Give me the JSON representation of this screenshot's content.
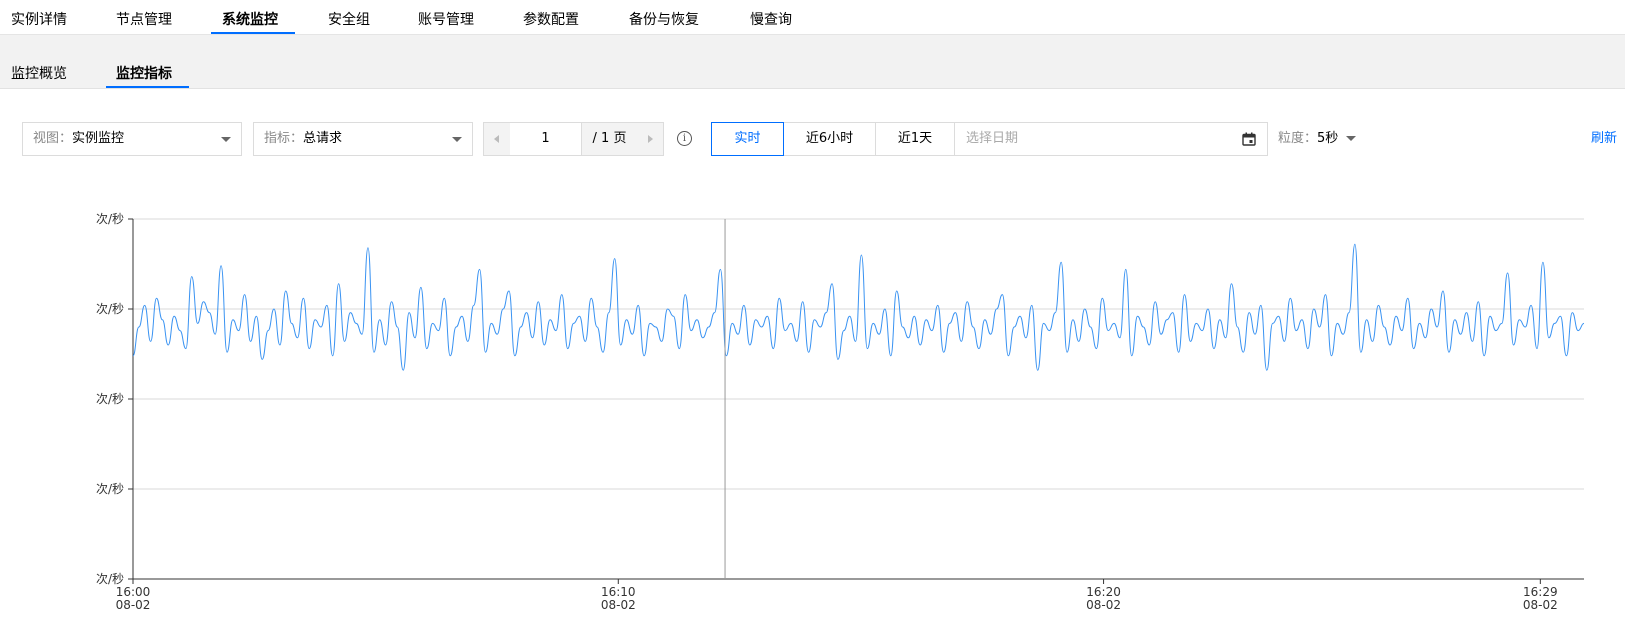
{
  "top_tabs": [
    {
      "label": "实例详情",
      "active": false
    },
    {
      "label": "节点管理",
      "active": false
    },
    {
      "label": "系统监控",
      "active": true
    },
    {
      "label": "安全组",
      "active": false
    },
    {
      "label": "账号管理",
      "active": false
    },
    {
      "label": "参数配置",
      "active": false
    },
    {
      "label": "备份与恢复",
      "active": false
    },
    {
      "label": "慢查询",
      "active": false
    }
  ],
  "sub_tabs": [
    {
      "label": "监控概览",
      "active": false
    },
    {
      "label": "监控指标",
      "active": true
    }
  ],
  "toolbar": {
    "view_label": "视图：",
    "view_value": "实例监控",
    "metric_label": "指标：",
    "metric_value": "总请求",
    "page_input": "1",
    "page_total": "/ 1 页",
    "info_icon_glyph": "i",
    "ranges": [
      {
        "label": "实时",
        "active": true
      },
      {
        "label": "近6小时",
        "active": false
      },
      {
        "label": "近1天",
        "active": false
      }
    ],
    "date_placeholder": "选择日期",
    "granularity_label": "粒度：",
    "granularity_value": "5秒",
    "refresh_label": "刷新"
  },
  "icons": {
    "info": "info-circle-icon",
    "calendar": "calendar-icon",
    "prev": "arrow-left-icon",
    "next": "arrow-right-icon",
    "dropdown": "chevron-down-icon"
  },
  "colors": {
    "accent": "#006eff",
    "series_line": "#3a93f2",
    "grid": "#d9d9d9",
    "axis": "#333333"
  },
  "chart_data": {
    "type": "line",
    "title": "",
    "xlabel": "",
    "ylabel": "",
    "y_tick_unit": "次/秒",
    "y_tick_count": 5,
    "grid": true,
    "x_ticks": [
      {
        "time": "16:00",
        "date": "08-02"
      },
      {
        "time": "16:10",
        "date": "08-02"
      },
      {
        "time": "16:20",
        "date": "08-02"
      },
      {
        "time": "16:29",
        "date": "08-02"
      }
    ],
    "x_range_minutes": [
      0,
      29.9
    ],
    "y_range_fraction": [
      0,
      1
    ],
    "hover_marker_minutes": 12.2,
    "series": [
      {
        "name": "",
        "values_fraction_of_axis": [
          0.62,
          0.7,
          0.76,
          0.66,
          0.78,
          0.72,
          0.65,
          0.73,
          0.69,
          0.64,
          0.84,
          0.71,
          0.77,
          0.74,
          0.68,
          0.87,
          0.63,
          0.72,
          0.69,
          0.79,
          0.66,
          0.73,
          0.61,
          0.69,
          0.75,
          0.65,
          0.8,
          0.71,
          0.67,
          0.78,
          0.64,
          0.72,
          0.7,
          0.76,
          0.62,
          0.82,
          0.66,
          0.74,
          0.71,
          0.68,
          0.92,
          0.63,
          0.72,
          0.65,
          0.77,
          0.7,
          0.58,
          0.74,
          0.67,
          0.81,
          0.64,
          0.71,
          0.69,
          0.78,
          0.62,
          0.7,
          0.73,
          0.66,
          0.76,
          0.86,
          0.63,
          0.71,
          0.68,
          0.75,
          0.8,
          0.62,
          0.7,
          0.74,
          0.67,
          0.77,
          0.65,
          0.72,
          0.69,
          0.79,
          0.64,
          0.71,
          0.73,
          0.66,
          0.78,
          0.7,
          0.63,
          0.74,
          0.89,
          0.65,
          0.72,
          0.68,
          0.76,
          0.62,
          0.71,
          0.7,
          0.66,
          0.75,
          0.73,
          0.64,
          0.79,
          0.69,
          0.72,
          0.67,
          0.7,
          0.74,
          0.86,
          0.62,
          0.71,
          0.68,
          0.76,
          0.65,
          0.72,
          0.7,
          0.73,
          0.64,
          0.78,
          0.69,
          0.71,
          0.66,
          0.77,
          0.63,
          0.72,
          0.7,
          0.74,
          0.82,
          0.61,
          0.69,
          0.73,
          0.66,
          0.9,
          0.64,
          0.71,
          0.68,
          0.75,
          0.62,
          0.8,
          0.7,
          0.67,
          0.73,
          0.65,
          0.72,
          0.69,
          0.76,
          0.63,
          0.71,
          0.74,
          0.66,
          0.77,
          0.7,
          0.64,
          0.72,
          0.68,
          0.75,
          0.79,
          0.62,
          0.7,
          0.73,
          0.67,
          0.76,
          0.58,
          0.71,
          0.69,
          0.74,
          0.88,
          0.63,
          0.72,
          0.66,
          0.75,
          0.7,
          0.64,
          0.78,
          0.69,
          0.71,
          0.67,
          0.86,
          0.62,
          0.73,
          0.7,
          0.65,
          0.77,
          0.68,
          0.72,
          0.74,
          0.63,
          0.79,
          0.66,
          0.71,
          0.69,
          0.75,
          0.64,
          0.72,
          0.67,
          0.82,
          0.7,
          0.63,
          0.74,
          0.68,
          0.76,
          0.58,
          0.71,
          0.73,
          0.66,
          0.78,
          0.69,
          0.72,
          0.64,
          0.75,
          0.7,
          0.79,
          0.62,
          0.71,
          0.68,
          0.74,
          0.93,
          0.63,
          0.72,
          0.66,
          0.76,
          0.7,
          0.65,
          0.73,
          0.69,
          0.78,
          0.64,
          0.71,
          0.67,
          0.75,
          0.7,
          0.8,
          0.63,
          0.72,
          0.68,
          0.74,
          0.66,
          0.77,
          0.62,
          0.73,
          0.69,
          0.71,
          0.85,
          0.65,
          0.72,
          0.7,
          0.76,
          0.64,
          0.88,
          0.67,
          0.71,
          0.73,
          0.62,
          0.74,
          0.69,
          0.71
        ]
      }
    ]
  }
}
